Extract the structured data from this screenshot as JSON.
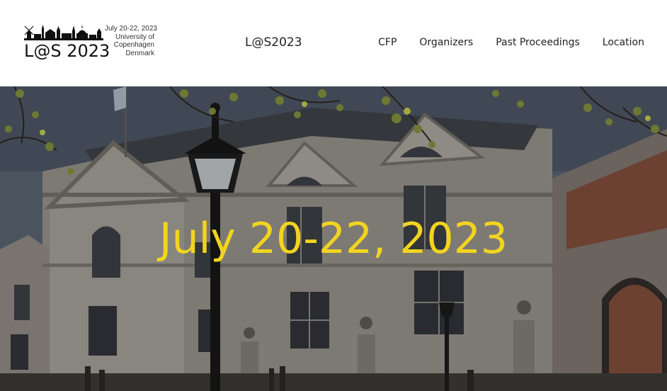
{
  "logo": {
    "mark_text": "L@S 2023",
    "details": [
      "July 20-22, 2023",
      "University of",
      "Copenhagen",
      "Denmark"
    ]
  },
  "header": {
    "site_title": "L@S2023"
  },
  "nav": {
    "items": [
      {
        "label": "CFP"
      },
      {
        "label": "Organizers"
      },
      {
        "label": "Past Proceedings"
      },
      {
        "label": "Location"
      }
    ]
  },
  "hero": {
    "date_text": "July 20-22, 2023",
    "date_color": "#f2d41e"
  }
}
